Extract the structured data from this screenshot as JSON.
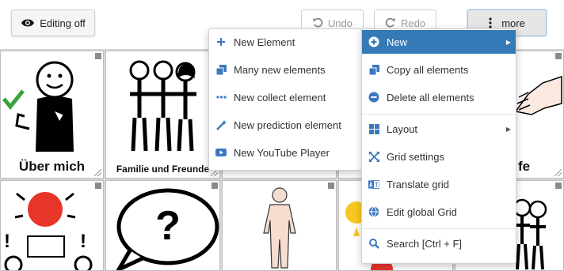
{
  "toolbar": {
    "editing_label": "Editing off",
    "undo_label": "Undo",
    "redo_label": "Redo",
    "more_label": "more"
  },
  "grid": {
    "cells": [
      {
        "label": "Über mich"
      },
      {
        "label": "Familie und Freunde"
      },
      {
        "label": ""
      },
      {
        "label": ""
      },
      {
        "label": "fe"
      }
    ]
  },
  "submenu": {
    "items": [
      {
        "label": "New Element",
        "icon": "plus-icon"
      },
      {
        "label": "Many new elements",
        "icon": "copy-icon"
      },
      {
        "label": "New collect element",
        "icon": "dots-icon"
      },
      {
        "label": "New prediction element",
        "icon": "magic-wand-icon"
      },
      {
        "label": "New YouTube Player",
        "icon": "youtube-icon"
      }
    ]
  },
  "menu": {
    "items": [
      {
        "label": "New",
        "icon": "plus-circle-icon",
        "active": true,
        "submenu": true
      },
      {
        "label": "Copy all elements",
        "icon": "copy-icon"
      },
      {
        "label": "Delete all elements",
        "icon": "minus-circle-icon"
      },
      {
        "label": "Layout",
        "icon": "grid-layout-icon",
        "submenu": true
      },
      {
        "label": "Grid settings",
        "icon": "expand-arrows-icon"
      },
      {
        "label": "Translate grid",
        "icon": "translate-icon"
      },
      {
        "label": "Edit global Grid",
        "icon": "globe-icon"
      },
      {
        "label": "Search [Ctrl + F]",
        "icon": "search-icon"
      }
    ]
  },
  "colors": {
    "accent": "#337ab7",
    "icon": "#3b78c0"
  }
}
